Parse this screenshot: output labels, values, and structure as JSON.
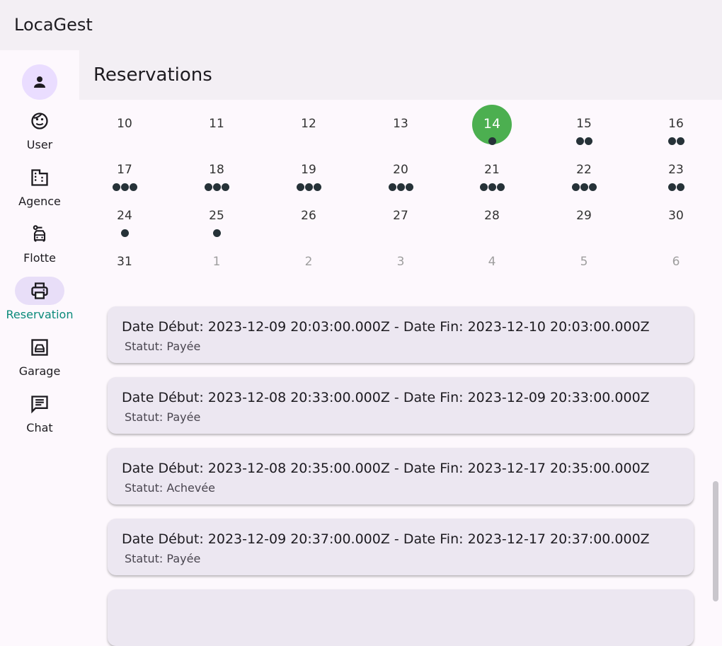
{
  "app": {
    "title": "LocaGest"
  },
  "page": {
    "title": "Reservations"
  },
  "rail": {
    "items": [
      {
        "label": "User",
        "icon": "face-icon",
        "active": false
      },
      {
        "label": "Agence",
        "icon": "building-icon",
        "active": false
      },
      {
        "label": "Flotte",
        "icon": "car-icon",
        "active": false
      },
      {
        "label": "Reservation",
        "icon": "printer-icon",
        "active": true
      },
      {
        "label": "Garage",
        "icon": "garage-icon",
        "active": false
      },
      {
        "label": "Chat",
        "icon": "chat-icon",
        "active": false
      }
    ]
  },
  "calendar": {
    "today": "14",
    "weeks": [
      [
        {
          "day": "10",
          "m": 0
        },
        {
          "day": "11",
          "m": 0
        },
        {
          "day": "12",
          "m": 0
        },
        {
          "day": "13",
          "m": 0
        },
        {
          "day": "14",
          "m": 1
        },
        {
          "day": "15",
          "m": 2
        },
        {
          "day": "16",
          "m": 2
        }
      ],
      [
        {
          "day": "17",
          "m": 3
        },
        {
          "day": "18",
          "m": 3
        },
        {
          "day": "19",
          "m": 3
        },
        {
          "day": "20",
          "m": 3
        },
        {
          "day": "21",
          "m": 3
        },
        {
          "day": "22",
          "m": 3
        },
        {
          "day": "23",
          "m": 2
        }
      ],
      [
        {
          "day": "24",
          "m": 1
        },
        {
          "day": "25",
          "m": 1
        },
        {
          "day": "26",
          "m": 0
        },
        {
          "day": "27",
          "m": 0
        },
        {
          "day": "28",
          "m": 0
        },
        {
          "day": "29",
          "m": 0
        },
        {
          "day": "30",
          "m": 0
        }
      ],
      [
        {
          "day": "31",
          "m": 0
        },
        {
          "day": "1",
          "m": 0,
          "out": true
        },
        {
          "day": "2",
          "m": 0,
          "out": true
        },
        {
          "day": "3",
          "m": 0,
          "out": true
        },
        {
          "day": "4",
          "m": 0,
          "out": true
        },
        {
          "day": "5",
          "m": 0,
          "out": true
        },
        {
          "day": "6",
          "m": 0,
          "out": true
        }
      ]
    ]
  },
  "reservations": [
    {
      "title": "Date Début: 2023-12-09 20:03:00.000Z - Date Fin: 2023-12-10 20:03:00.000Z",
      "status": "Statut: Payée"
    },
    {
      "title": "Date Début: 2023-12-08 20:33:00.000Z - Date Fin: 2023-12-09 20:33:00.000Z",
      "status": "Statut: Payée"
    },
    {
      "title": "Date Début: 2023-12-08 20:35:00.000Z - Date Fin: 2023-12-17 20:35:00.000Z",
      "status": "Statut: Achevée"
    },
    {
      "title": "Date Début: 2023-12-09 20:37:00.000Z - Date Fin: 2023-12-17 20:37:00.000Z",
      "status": "Statut: Payée"
    },
    {
      "title": "",
      "status": ""
    }
  ],
  "colors": {
    "today": "#4caf50",
    "active_label": "#0a8a7a",
    "marker": "#263238"
  }
}
